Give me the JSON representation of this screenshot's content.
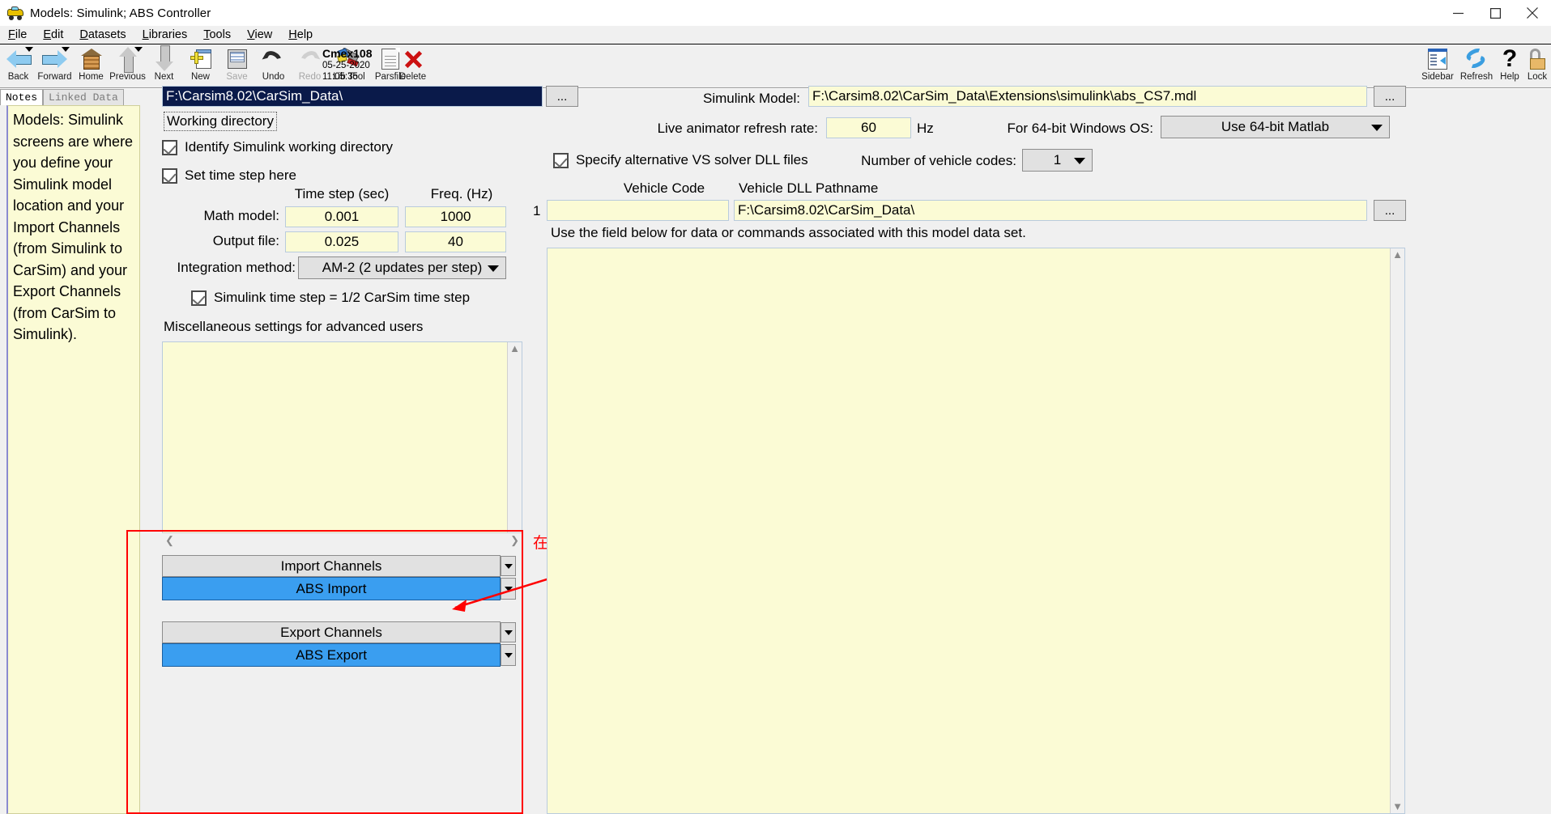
{
  "window": {
    "title": "Models: Simulink;  ABS Controller",
    "icon": "car-icon",
    "minimize": "minimize-icon",
    "maximize": "maximize-icon",
    "close": "close-icon"
  },
  "menubar": [
    {
      "label": "File",
      "accel": "F"
    },
    {
      "label": "Edit",
      "accel": "E"
    },
    {
      "label": "Datasets",
      "accel": "D"
    },
    {
      "label": "Libraries",
      "accel": "L"
    },
    {
      "label": "Tools",
      "accel": "T"
    },
    {
      "label": "View",
      "accel": "V"
    },
    {
      "label": "Help",
      "accel": "H"
    }
  ],
  "toolbar": {
    "left_buttons": [
      {
        "label": "Back",
        "icon": "back-arrow-icon",
        "dropdown": true,
        "enabled": true
      },
      {
        "label": "Forward",
        "icon": "forward-arrow-icon",
        "dropdown": true,
        "enabled": true
      },
      {
        "label": "Home",
        "icon": "home-icon",
        "dropdown": false,
        "enabled": true
      },
      {
        "label": "Previous",
        "icon": "up-arrow-icon",
        "dropdown": true,
        "enabled": true
      },
      {
        "label": "Next",
        "icon": "down-arrow-icon",
        "dropdown": false,
        "enabled": true
      },
      {
        "label": "New",
        "icon": "new-document-icon",
        "dropdown": false,
        "enabled": true
      },
      {
        "label": "Save",
        "icon": "floppy-disk-icon",
        "dropdown": false,
        "enabled": false
      },
      {
        "label": "Undo",
        "icon": "undo-arrow-icon",
        "dropdown": false,
        "enabled": true
      },
      {
        "label": "Redo",
        "icon": "redo-arrow-icon",
        "dropdown": false,
        "enabled": false
      },
      {
        "label": "Lib Tool",
        "icon": "wrench-tool-icon",
        "dropdown": false,
        "enabled": true
      },
      {
        "label": "Parsfile",
        "icon": "document-icon",
        "dropdown": false,
        "enabled": true
      }
    ],
    "parsfile": {
      "name": "Cmex108",
      "timestamp": "05-25-2020 11:05:35"
    },
    "delete": {
      "label": "Delete",
      "icon": "red-x-icon"
    },
    "right_buttons": [
      {
        "label": "Sidebar",
        "icon": "sidebar-panel-icon"
      },
      {
        "label": "Refresh",
        "icon": "refresh-circular-icon"
      },
      {
        "label": "Help",
        "icon": "question-mark-icon"
      },
      {
        "label": "Lock",
        "icon": "padlock-icon"
      }
    ]
  },
  "notes_panel": {
    "tabs": [
      {
        "label": "Notes",
        "active": true
      },
      {
        "label": "Linked Data",
        "active": false
      }
    ],
    "text": "Models: Simulink screens are where you define your Simulink model location and your Import Channels (from Simulink to CarSim) and your Export Channels (from CarSim to Simulink)."
  },
  "left_form": {
    "working_directory": {
      "value": "F:\\Carsim8.02\\CarSim_Data\\",
      "selected": true,
      "label": "Working directory",
      "browse_button": "..."
    },
    "identify_working_dir": {
      "label": "Identify Simulink working directory",
      "checked": true
    },
    "set_time_step": {
      "label": "Set time step here",
      "checked": true
    },
    "time_table": {
      "col_headers": [
        "Time step (sec)",
        "Freq. (Hz)"
      ],
      "rows": [
        {
          "label": "Math model:",
          "time_step": "0.001",
          "freq": "1000"
        },
        {
          "label": "Output file:",
          "time_step": "0.025",
          "freq": "40"
        }
      ]
    },
    "integration_method": {
      "label": "Integration method:",
      "value": "AM-2 (2 updates per step)"
    },
    "half_step": {
      "label": "Simulink time step = 1/2 CarSim time step",
      "checked": true
    },
    "misc_settings_label": "Miscellaneous settings for advanced users",
    "misc_settings_value": "",
    "import_channels": {
      "header": "Import Channels",
      "value": "ABS Import"
    },
    "export_channels": {
      "header": "Export Channels",
      "value": "ABS Export"
    }
  },
  "right_form": {
    "simulink_model": {
      "label": "Simulink Model:",
      "value": "F:\\Carsim8.02\\CarSim_Data\\Extensions\\simulink\\abs_CS7.mdl",
      "browse_button": "..."
    },
    "live_animator": {
      "label": "Live animator refresh rate:",
      "value": "60",
      "unit": "Hz"
    },
    "os_bits": {
      "label": "For 64-bit Windows OS:",
      "value": "Use 64-bit Matlab"
    },
    "specify_dll": {
      "label": "Specify alternative VS solver DLL files",
      "checked": true
    },
    "num_vehicle_codes": {
      "label": "Number of vehicle codes:",
      "value": "1"
    },
    "vehicle_table": {
      "col_headers": [
        "Vehicle Code",
        "Vehicle DLL  Pathname"
      ],
      "rows": [
        {
          "index": "1",
          "code": "",
          "dll_path": "F:\\Carsim8.02\\CarSim_Data\\",
          "browse_button": "..."
        }
      ]
    },
    "commands_label": "Use the field below  for data or commands associated with this model data set.",
    "commands_value": ""
  },
  "annotation": {
    "text": "在此处进行输入输出的设置，按照自己的需求新建等",
    "color": "#ff0000"
  },
  "colors": {
    "field_yellow": "#fbfbd5",
    "selection_blue": "#0a1a4a",
    "channel_blue": "#3a9ef0",
    "panel_gray": "#f0f0f0",
    "annotation_red": "#ff0000"
  }
}
